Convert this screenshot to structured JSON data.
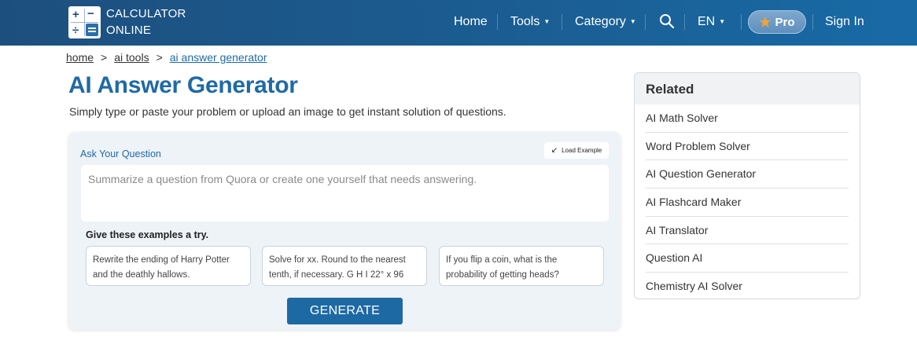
{
  "header": {
    "logo_line1": "CALCULATOR",
    "logo_line2": "ONLINE",
    "nav": {
      "home": "Home",
      "tools": "Tools",
      "category": "Category",
      "lang": "EN",
      "pro": "Pro",
      "signin": "Sign In"
    },
    "colors": {
      "bar": "#1b5d92",
      "accent": "#1f6aa5"
    }
  },
  "breadcrumb": [
    "home",
    "ai tools",
    "ai answer generator"
  ],
  "page": {
    "title": "AI Answer Generator",
    "subtitle": "Simply type or paste your problem or upload an image to get instant solution of questions."
  },
  "form": {
    "ask_label": "Ask Your Question",
    "load_example": "Load Example",
    "placeholder": "Summarize a question from Quora or create one yourself that needs answering.",
    "examples_label": "Give these examples a try.",
    "examples": [
      "Rewrite the ending of Harry Potter and the deathly hallows.",
      "Solve for xx. Round to the nearest tenth, if necessary. G H I 22° x 96",
      "If you flip a coin, what is the probability of getting heads?"
    ],
    "generate": "GENERATE"
  },
  "related": {
    "title": "Related",
    "items": [
      "AI Math Solver",
      "Word Problem Solver",
      "AI Question Generator",
      "AI Flashcard Maker",
      "AI Translator",
      "Question AI",
      "Chemistry AI Solver"
    ]
  }
}
